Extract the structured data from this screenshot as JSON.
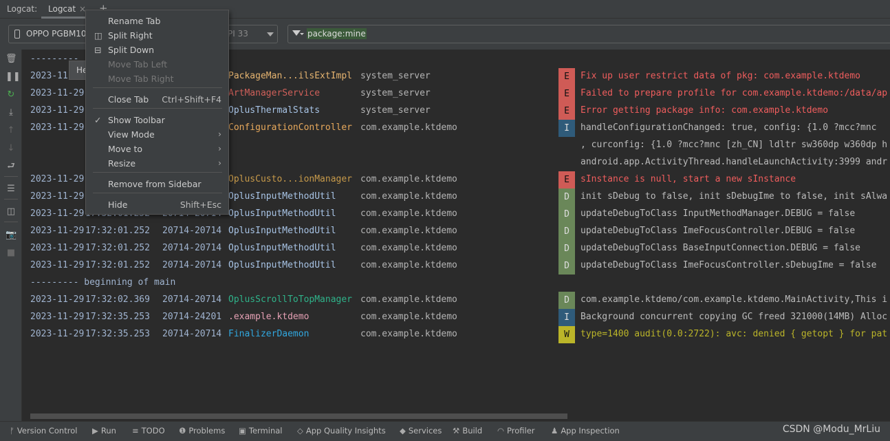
{
  "tabbar": {
    "label": "Logcat:",
    "tab": "Logcat",
    "close": "×",
    "add": "+"
  },
  "toolbar": {
    "device": "OPPO PGBM10",
    "api": "PI 33",
    "filter": "package:mine"
  },
  "tooltip": "He",
  "menu": [
    {
      "label": "Rename Tab"
    },
    {
      "label": "Split Right",
      "icon": "split-right-icon"
    },
    {
      "label": "Split Down",
      "icon": "split-down-icon"
    },
    {
      "label": "Move Tab Left",
      "disabled": true
    },
    {
      "label": "Move Tab Right",
      "disabled": true
    },
    {
      "label": "Close Tab",
      "shortcut": "Ctrl+Shift+F4"
    },
    {
      "label": "Show Toolbar",
      "checked": true
    },
    {
      "label": "View Mode",
      "submenu": true
    },
    {
      "label": "Move to",
      "submenu": true
    },
    {
      "label": "Resize",
      "submenu": true
    },
    {
      "label": "Remove from Sidebar"
    },
    {
      "label": "Hide",
      "shortcut": "Shift+Esc"
    }
  ],
  "colors": {
    "E": "#cf5b56",
    "I": "#2f5b7a",
    "D": "#6a8759",
    "W": "#bbb529",
    "msgE": "#ef5d5d",
    "msgW": "#bbb529",
    "msg": "#bbbbbb"
  },
  "log": [
    {
      "sep": "---------"
    },
    {
      "date": "2023-11",
      "tag": "PackageMan...ilsExtImpl",
      "tagColor": "#e6b470",
      "pkg": "system_server",
      "level": "E",
      "msg": "Fix up user restrict data of pkg: com.example.ktdemo"
    },
    {
      "date": "2023-11-29",
      "tag": "ArtManagerService",
      "tagColor": "#d0605a",
      "pkg": "system_server",
      "level": "E",
      "msg": "Failed to prepare profile for com.example.ktdemo:/data/ap"
    },
    {
      "date": "2023-11-29",
      "tag": "OplusThermalStats",
      "tagColor": "#a8c4e6",
      "pkg": "system_server",
      "level": "E",
      "msg": "Error getting package info: com.example.ktdemo"
    },
    {
      "date": "2023-11-29",
      "tag": "ConfigurationController",
      "tagColor": "#e8a95c",
      "pkg": "com.example.ktdemo",
      "level": "I",
      "msg": "handleConfigurationChanged: true, config: {1.0 ?mcc?mnc"
    },
    {
      "cont": ", curconfig: {1.0 ?mcc?mnc [zh_CN] ldltr sw360dp w360dp h"
    },
    {
      "cont": "android.app.ActivityThread.handleLaunchActivity:3999 andr"
    },
    {
      "date": "2023-11-29",
      "tag": "OplusCusto...ionManager",
      "tagColor": "#c79a4a",
      "pkg": "com.example.ktdemo",
      "level": "E",
      "msg": "sInstance is null, start a new sInstance"
    },
    {
      "date": "2023-11-29",
      "tag": "OplusInputMethodUtil",
      "tagColor": "#a8c4e6",
      "pkg": "com.example.ktdemo",
      "level": "D",
      "msg": "init sDebug to false, init sDebugIme to false, init sAlwa"
    },
    {
      "date": "2023-11-29",
      "time": "17:32:01.252",
      "pid": "20714-20714",
      "tag": "OplusInputMethodUtil",
      "tagColor": "#a8c4e6",
      "pkg": "com.example.ktdemo",
      "level": "D",
      "msg": "updateDebugToClass InputMethodManager.DEBUG = false"
    },
    {
      "date": "2023-11-29",
      "time": "17:32:01.252",
      "pid": "20714-20714",
      "tag": "OplusInputMethodUtil",
      "tagColor": "#a8c4e6",
      "pkg": "com.example.ktdemo",
      "level": "D",
      "msg": "updateDebugToClass ImeFocusController.DEBUG = false"
    },
    {
      "date": "2023-11-29",
      "time": "17:32:01.252",
      "pid": "20714-20714",
      "tag": "OplusInputMethodUtil",
      "tagColor": "#a8c4e6",
      "pkg": "com.example.ktdemo",
      "level": "D",
      "msg": "updateDebugToClass BaseInputConnection.DEBUG = false"
    },
    {
      "date": "2023-11-29",
      "time": "17:32:01.252",
      "pid": "20714-20714",
      "tag": "OplusInputMethodUtil",
      "tagColor": "#a8c4e6",
      "pkg": "com.example.ktdemo",
      "level": "D",
      "msg": "updateDebugToClass ImeFocusController.sDebugIme = false"
    },
    {
      "sep": "--------- beginning of main"
    },
    {
      "date": "2023-11-29",
      "time": "17:32:02.369",
      "pid": "20714-20714",
      "tag": "OplusScrollToTopManager",
      "tagColor": "#2fb38a",
      "pkg": "com.example.ktdemo",
      "level": "D",
      "msg": "com.example.ktdemo/com.example.ktdemo.MainActivity,This i"
    },
    {
      "date": "2023-11-29",
      "time": "17:32:35.253",
      "pid": "20714-24201",
      "tag": ".example.ktdemo",
      "tagColor": "#e5a0b4",
      "pkg": "com.example.ktdemo",
      "level": "I",
      "msg": "Background concurrent copying GC freed 321000(14MB) Alloc"
    },
    {
      "date": "2023-11-29",
      "time": "17:32:35.253",
      "pid": "20714-20714",
      "tag": "FinalizerDaemon",
      "tagColor": "#31a8e0",
      "pkg": "com.example.ktdemo",
      "level": "W",
      "msg": "type=1400 audit(0.0:2722): avc: denied { getopt } for pat"
    }
  ],
  "statusbar": [
    {
      "label": "Version Control",
      "icon": "version-control-icon"
    },
    {
      "label": "Run",
      "icon": "run-icon"
    },
    {
      "label": "TODO",
      "icon": "todo-icon"
    },
    {
      "label": "Problems",
      "icon": "problems-icon"
    },
    {
      "label": "Terminal",
      "icon": "terminal-icon"
    },
    {
      "label": "App Quality Insights",
      "icon": "app-quality-icon"
    },
    {
      "label": "Services",
      "icon": "services-icon"
    },
    {
      "label": "Build",
      "icon": "build-icon"
    },
    {
      "label": "Profiler",
      "icon": "profiler-icon"
    },
    {
      "label": "App Inspection",
      "icon": "app-inspection-icon"
    }
  ],
  "watermark": "CSDN @Modu_MrLiu"
}
